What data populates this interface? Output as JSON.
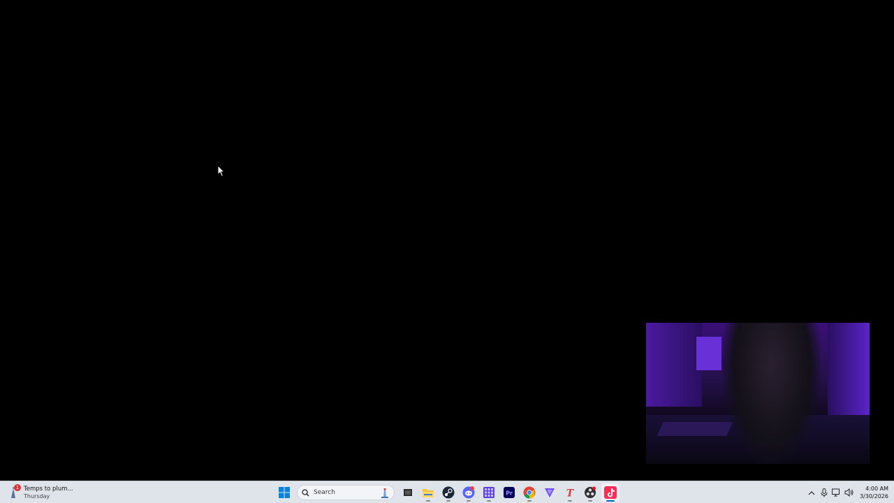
{
  "taskbar": {
    "weather": {
      "title": "Temps to plum...",
      "subtitle": "Thursday",
      "badge_count": "1",
      "icon": "weather-icon"
    },
    "search": {
      "placeholder": "Search"
    },
    "apps": [
      {
        "name": "start",
        "icon": "windows-logo-icon"
      },
      {
        "name": "task-view",
        "icon": "task-view-icon"
      },
      {
        "name": "file-explorer",
        "icon": "folder-icon"
      },
      {
        "name": "steam",
        "icon": "steam-icon"
      },
      {
        "name": "discord",
        "icon": "discord-icon"
      },
      {
        "name": "calculator-grid",
        "icon": "grid-app-icon"
      },
      {
        "name": "premiere-pro",
        "icon": "premiere-pro-icon",
        "label": "Pr"
      },
      {
        "name": "chrome",
        "icon": "chrome-icon"
      },
      {
        "name": "proton-vpn",
        "icon": "vpn-icon"
      },
      {
        "name": "typora",
        "icon": "t-app-icon",
        "label": "T"
      },
      {
        "name": "obs",
        "icon": "obs-icon"
      },
      {
        "name": "tiktok",
        "icon": "tiktok-icon"
      }
    ],
    "clock": {
      "time": "4:00 AM",
      "date": "3/30/2026"
    }
  },
  "colors": {
    "taskbar_bg": "#dfe3ea",
    "accent": "#0067c0",
    "desktop_bg": "#000000"
  }
}
